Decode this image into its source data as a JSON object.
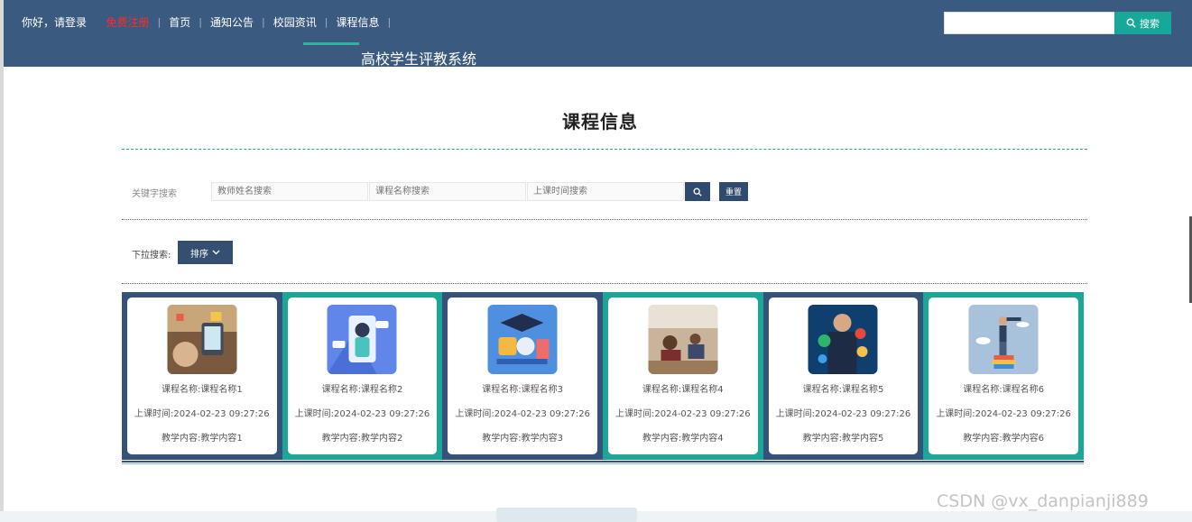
{
  "header": {
    "greeting": "你好，请登录",
    "register": "免费注册",
    "nav": [
      "首页",
      "通知公告",
      "校园资讯",
      "课程信息"
    ],
    "site_title": "高校学生评教系统",
    "search_placeholder": "",
    "search_label": "搜索"
  },
  "page": {
    "title": "课程信息",
    "keyword_label": "关键字搜索",
    "filters": {
      "teacher": "教师姓名搜索",
      "course": "课程名称搜索",
      "time": "上课时间搜索"
    },
    "reset_label": "重置",
    "dropdown_label": "下拉搜索:",
    "sort_label": "排序"
  },
  "courses": [
    {
      "name": "课程名称:课程名称1",
      "time": "上课时间:2024-02-23 09:27:26",
      "content": "教学内容:教学内容1"
    },
    {
      "name": "课程名称:课程名称2",
      "time": "上课时间:2024-02-23 09:27:26",
      "content": "教学内容:教学内容2"
    },
    {
      "name": "课程名称:课程名称3",
      "time": "上课时间:2024-02-23 09:27:26",
      "content": "教学内容:教学内容3"
    },
    {
      "name": "课程名称:课程名称4",
      "time": "上课时间:2024-02-23 09:27:26",
      "content": "教学内容:教学内容4"
    },
    {
      "name": "课程名称:课程名称5",
      "time": "上课时间:2024-02-23 09:27:26",
      "content": "教学内容:教学内容5"
    },
    {
      "name": "课程名称:课程名称6",
      "time": "上课时间:2024-02-23 09:27:26",
      "content": "教学内容:教学内容6"
    }
  ],
  "watermark": "CSDN @vx_danpianji889",
  "colors": {
    "header_bg": "#3a5a7f",
    "accent_teal": "#1da597",
    "navy": "#34527a",
    "register_red": "#ff2a2a"
  },
  "icons": {
    "search": "search-icon",
    "sort_caret": "chevron-down-icon"
  }
}
